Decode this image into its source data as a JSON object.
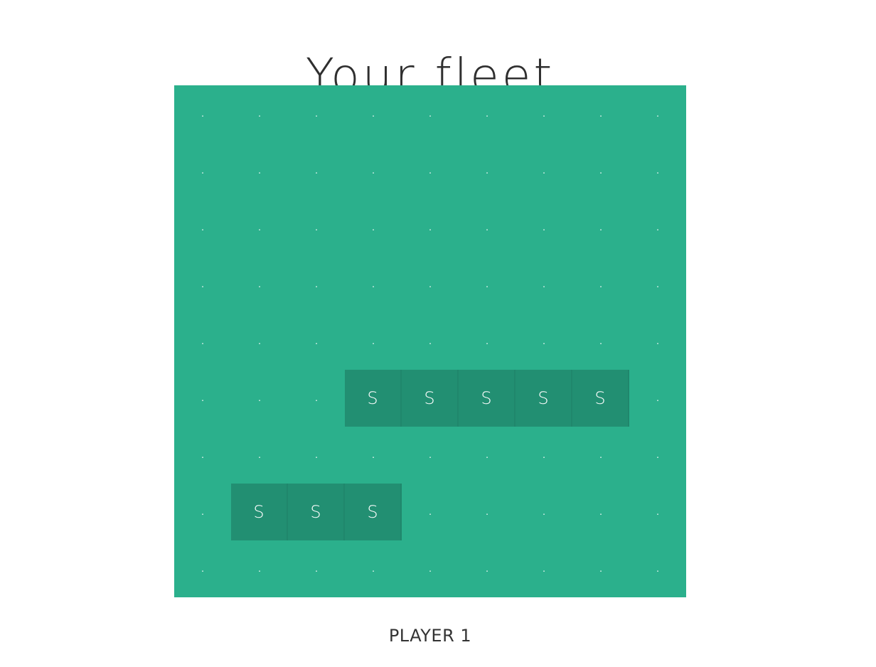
{
  "title": "Your fleet",
  "player_label": "PLAYER 1",
  "colors": {
    "water": "#2bb08c",
    "ship": "#228f72",
    "mark": "#ffffff"
  },
  "board": {
    "cols": 9,
    "rows": 9,
    "empty_mark": ".",
    "ship_mark": "S",
    "grid": [
      [
        ".",
        ".",
        ".",
        ".",
        ".",
        ".",
        ".",
        ".",
        "."
      ],
      [
        ".",
        ".",
        ".",
        ".",
        ".",
        ".",
        ".",
        ".",
        "."
      ],
      [
        ".",
        ".",
        ".",
        ".",
        ".",
        ".",
        ".",
        ".",
        "."
      ],
      [
        ".",
        ".",
        ".",
        ".",
        ".",
        ".",
        ".",
        ".",
        "."
      ],
      [
        ".",
        ".",
        ".",
        ".",
        ".",
        ".",
        ".",
        ".",
        "."
      ],
      [
        ".",
        ".",
        ".",
        "S",
        "S",
        "S",
        "S",
        "S",
        "."
      ],
      [
        ".",
        ".",
        ".",
        ".",
        ".",
        ".",
        ".",
        ".",
        "."
      ],
      [
        ".",
        "S",
        "S",
        "S",
        ".",
        ".",
        ".",
        ".",
        "."
      ],
      [
        ".",
        ".",
        ".",
        ".",
        ".",
        ".",
        ".",
        ".",
        "."
      ]
    ]
  }
}
